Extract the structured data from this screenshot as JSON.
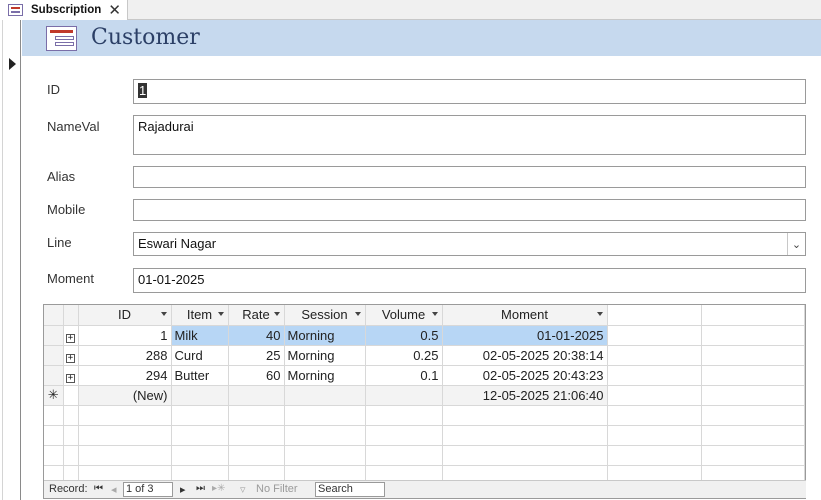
{
  "tab": {
    "title": "Subscription",
    "close_glyph": "✕"
  },
  "form": {
    "title": "Customer"
  },
  "fields": {
    "id": {
      "label": "ID",
      "value": "1"
    },
    "name": {
      "label": "NameVal",
      "value": "Rajadurai"
    },
    "alias": {
      "label": "Alias",
      "value": ""
    },
    "mobile": {
      "label": "Mobile",
      "value": ""
    },
    "line": {
      "label": "Line",
      "value": "Eswari Nagar"
    },
    "moment": {
      "label": "Moment",
      "value": "01-01-2025"
    }
  },
  "subgrid": {
    "columns": [
      "ID",
      "Item",
      "Rate",
      "Session",
      "Volume",
      "Moment"
    ],
    "rows": [
      {
        "id": "1",
        "item": "Milk",
        "rate": "40",
        "session": "Morning",
        "volume": "0.5",
        "moment": "01-01-2025"
      },
      {
        "id": "288",
        "item": "Curd",
        "rate": "25",
        "session": "Morning",
        "volume": "0.25",
        "moment": "02-05-2025 20:38:14"
      },
      {
        "id": "294",
        "item": "Butter",
        "rate": "60",
        "session": "Morning",
        "volume": "0.1",
        "moment": "02-05-2025 20:43:23"
      }
    ],
    "new_row": {
      "id": "(New)",
      "moment": "12-05-2025 21:06:40",
      "marker": "✳"
    },
    "expander_glyph": "+"
  },
  "navigator": {
    "record_label": "Record:",
    "first": "⏮",
    "prev": "◂",
    "position": "1 of 3",
    "next": "▸",
    "last": "⏭",
    "new": "▸✳",
    "filter_label": "No Filter",
    "search_placeholder": "Search"
  },
  "colors": {
    "header_band": "#c6d9ee",
    "selection": "#b7d6f5",
    "title": "#2b3f66"
  }
}
